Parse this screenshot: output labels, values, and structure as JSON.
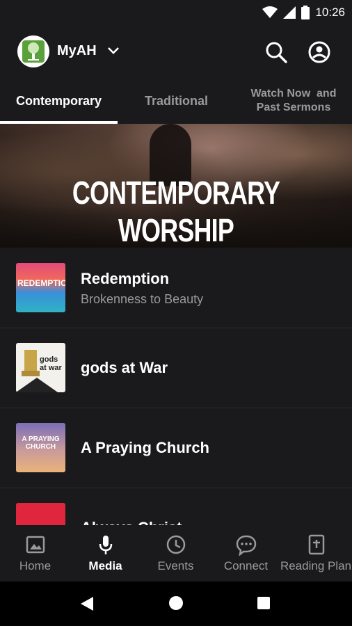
{
  "status_bar": {
    "time": "10:26",
    "icons": [
      "wifi-icon",
      "signal-icon",
      "battery-icon"
    ]
  },
  "app_bar": {
    "title": "MyAH",
    "logo": "church-logo",
    "icons": [
      "chevron-down-icon",
      "search-icon",
      "account-icon"
    ]
  },
  "tabs": [
    {
      "label": "Contemporary",
      "active": true
    },
    {
      "label": "Traditional",
      "active": false
    },
    {
      "label_line1": "Watch Now  and",
      "label_line2": "Past Sermons",
      "active": false
    }
  ],
  "hero": {
    "title": "CONTEMPORARY WORSHIP"
  },
  "series": [
    {
      "title": "Redemption",
      "subtitle": "Brokenness to Beauty",
      "thumb_text": "REDEMPTION"
    },
    {
      "title": "gods at War",
      "subtitle": "",
      "thumb_text": "gods at war"
    },
    {
      "title": "A Praying Church",
      "subtitle": "",
      "thumb_text": "A PRAYING CHURCH"
    },
    {
      "title": "Always Christ",
      "subtitle": "",
      "thumb_text": ""
    }
  ],
  "bottom_nav": [
    {
      "label": "Home",
      "icon": "image-icon",
      "active": false
    },
    {
      "label": "Media",
      "icon": "microphone-icon",
      "active": true
    },
    {
      "label": "Events",
      "icon": "clock-icon",
      "active": false
    },
    {
      "label": "Connect",
      "icon": "chat-bubble-icon",
      "active": false
    },
    {
      "label": "Reading Plan",
      "icon": "bible-icon",
      "active": false
    }
  ],
  "colors": {
    "background": "#1a1a1c",
    "text_primary": "#ffffff",
    "text_secondary": "#9a9a9a",
    "logo_green": "#5aa13c"
  }
}
